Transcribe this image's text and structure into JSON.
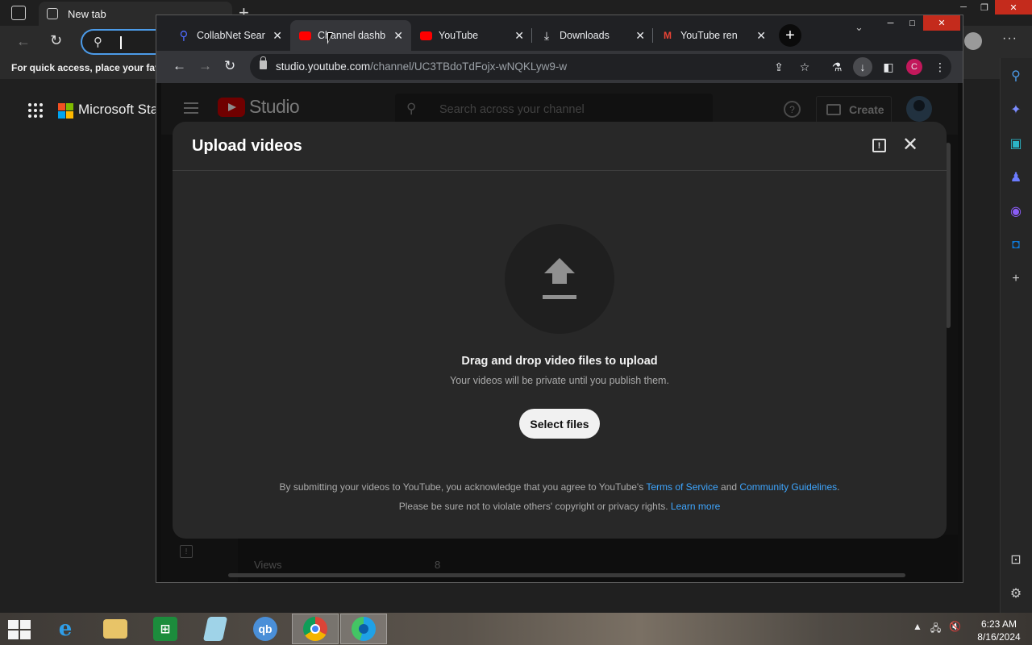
{
  "edge": {
    "tab_title": "New tab",
    "favbar_text": "For quick access, place your favo",
    "brand_text": "Microsoft Sta"
  },
  "chrome": {
    "tabs": [
      {
        "title": "CollabNet Sear",
        "favicon": "search-icon",
        "active": false
      },
      {
        "title": "Channel dashb",
        "favicon": "youtube-icon",
        "active": true
      },
      {
        "title": "YouTube",
        "favicon": "youtube-icon",
        "active": false
      },
      {
        "title": "Downloads",
        "favicon": "download-icon",
        "active": false
      },
      {
        "title": "YouTube ren",
        "favicon": "gmail-icon",
        "active": false
      }
    ],
    "url_host": "studio.youtube.com",
    "url_path": "/channel/UC3TBdoTdFojx-wNQKLyw9-w",
    "profile_initial": "C",
    "colors": {
      "accent_link": "#3ea6ff",
      "profile": "#c2185b",
      "youtube_red": "#cc0000"
    }
  },
  "studio": {
    "logo_text": "Studio",
    "search_placeholder": "Search across your channel",
    "create_label": "Create",
    "help_glyph": "?",
    "bg_row_label": "Views",
    "bg_row_value": "8"
  },
  "dialog": {
    "title": "Upload videos",
    "drag_text": "Drag and drop video files to upload",
    "private_text": "Your videos will be private until you publish them.",
    "select_button": "Select files",
    "legal1_pre": "By submitting your videos to YouTube, you acknowledge that you agree to YouTube's",
    "terms_link": "Terms of Service",
    "legal1_and": "and",
    "guidelines_link": "Community Guidelines",
    "legal1_end": ".",
    "legal2_pre": "Please be sure not to violate others' copyright or privacy rights.",
    "learn_more_link": "Learn more"
  },
  "taskbar": {
    "apps": [
      "internet-explorer",
      "file-explorer",
      "store",
      "notepad",
      "qbittorrent",
      "chrome",
      "edge"
    ],
    "time": "6:23 AM",
    "date": "8/16/2024"
  }
}
